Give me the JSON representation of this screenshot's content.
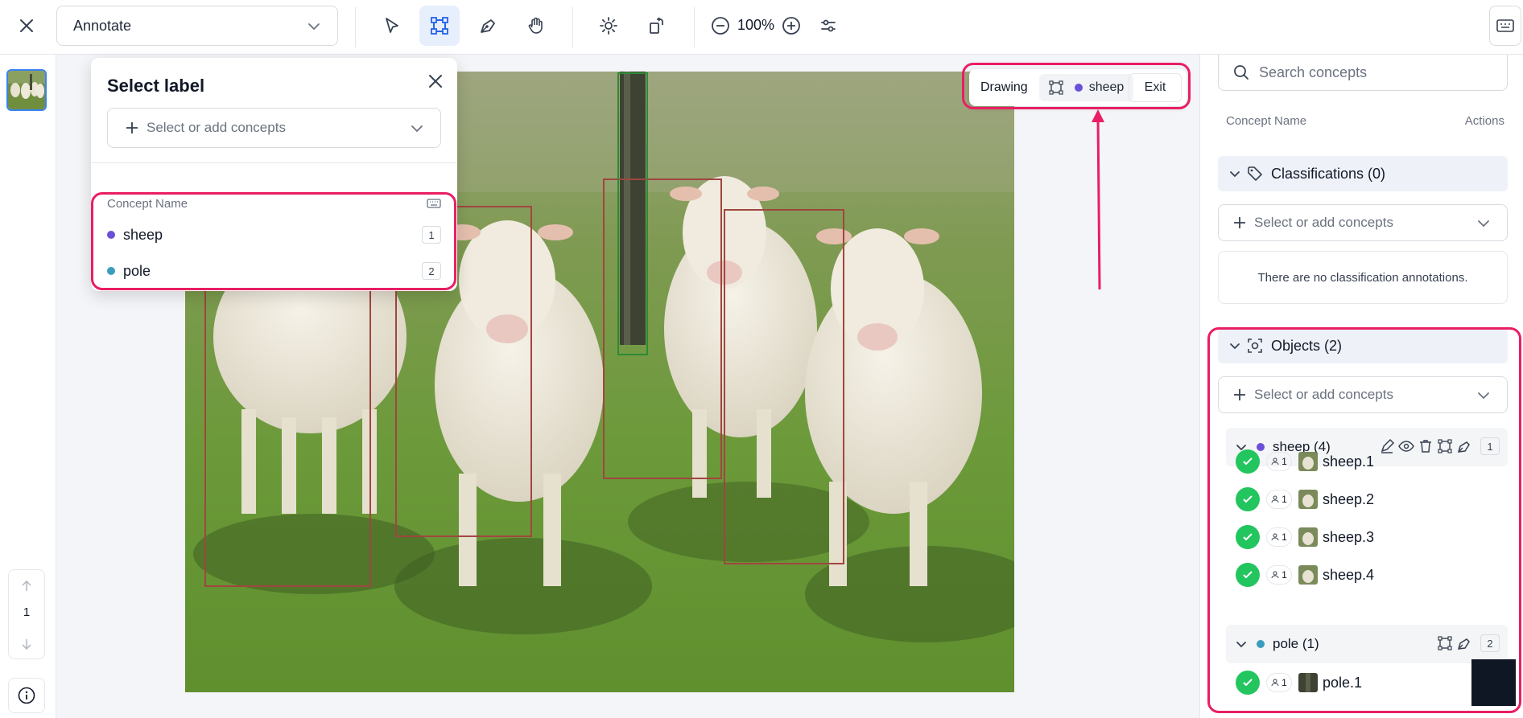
{
  "toolbar": {
    "mode": "Annotate",
    "zoom": "100%"
  },
  "pager": {
    "current": "1"
  },
  "popup": {
    "title": "Select label",
    "select_placeholder": "Select or add concepts",
    "list_header": "Concept Name",
    "items": [
      {
        "name": "sheep",
        "key": "1",
        "color": "#6a4fd8"
      },
      {
        "name": "pole",
        "key": "2",
        "color": "#3a9dbd"
      }
    ]
  },
  "drawing": {
    "label": "Drawing",
    "concept": "sheep",
    "exit": "Exit"
  },
  "panel": {
    "search_placeholder": "Search concepts",
    "col_name": "Concept Name",
    "col_actions": "Actions",
    "classifications_title": "Classifications (0)",
    "classifications_select": "Select or add concepts",
    "no_classifications": "There are no classification annotations.",
    "objects_title": "Objects (2)",
    "objects_select": "Select or add concepts",
    "groups": [
      {
        "name": "sheep (4)",
        "key": "1",
        "color": "#6a4fd8",
        "items": [
          {
            "name": "sheep.1",
            "count": "1"
          },
          {
            "name": "sheep.2",
            "count": "1"
          },
          {
            "name": "sheep.3",
            "count": "1"
          },
          {
            "name": "sheep.4",
            "count": "1"
          }
        ]
      },
      {
        "name": "pole (1)",
        "key": "2",
        "color": "#3a9dbd",
        "items": [
          {
            "name": "pole.1",
            "count": "1"
          }
        ]
      }
    ]
  },
  "colors": {
    "accent": "#3b82f6",
    "highlight": "#e91e63",
    "success": "#22c55e"
  }
}
